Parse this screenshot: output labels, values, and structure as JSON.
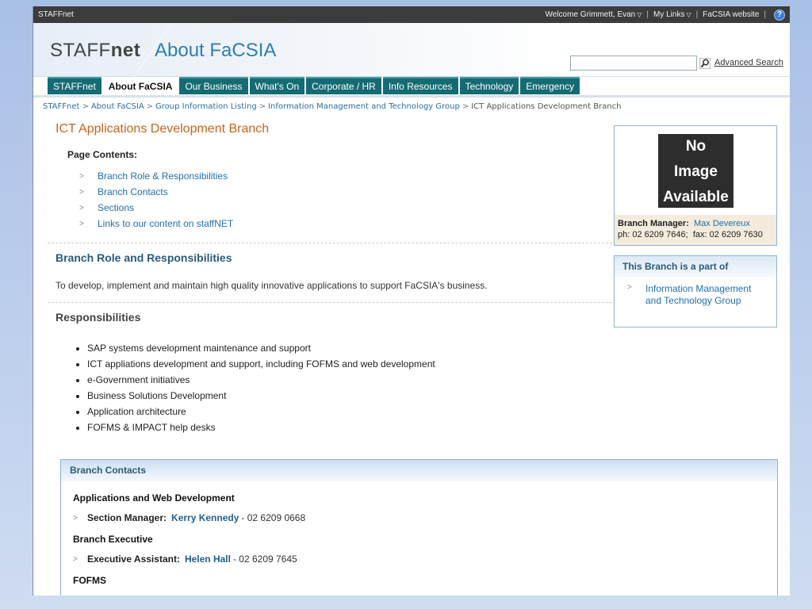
{
  "topbar": {
    "site_name": "STAFFnet",
    "welcome": "Welcome Grimmett, Evan",
    "my_links": "My Links",
    "facsia_website": "FaCSIA website",
    "help": "?"
  },
  "header": {
    "logo_light": "STAFF",
    "logo_bold": "net",
    "section_title": "About FaCSIA",
    "search_placeholder": "",
    "advanced_search": "Advanced Search"
  },
  "nav": {
    "tabs": [
      "STAFFnet",
      "About FaCSIA",
      "Our Business",
      "What's On",
      "Corporate / HR",
      "Info Resources",
      "Technology",
      "Emergency"
    ],
    "active": "About FaCSIA"
  },
  "breadcrumb": {
    "items": [
      "STAFFnet",
      "About FaCSIA",
      "Group Information Listing",
      "Information Management and Technology Group"
    ],
    "current": "ICT Applications Development Branch"
  },
  "main": {
    "title": "ICT Applications Development Branch",
    "contents_label": "Page Contents:",
    "toc": [
      "Branch Role & Responsibilities",
      "Branch Contacts",
      "Sections",
      "Links to our content on staffNET"
    ],
    "role_heading": "Branch Role and Responsibilities",
    "role_text": "To develop, implement and maintain high quality innovative applications to support FaCSIA's business.",
    "resp_heading": "Responsibilities",
    "responsibilities": [
      "SAP systems development maintenance and support",
      "ICT appliations development and support, including FOFMS and web development",
      "e-Government initiatives",
      "Business Solutions Development",
      "Application architecture",
      "FOFMS & IMPACT help desks"
    ]
  },
  "sidebar": {
    "no_image_lines": [
      "No",
      "Image",
      "Available"
    ],
    "manager_label": "Branch Manager:",
    "manager_name": "Max Devereux",
    "manager_phone": "ph: 02 6209 7646;",
    "manager_fax": "fax: 02 6209 7630",
    "part_of_heading": "This Branch is a part of",
    "part_of_link": "Information Management and Technology Group"
  },
  "contacts": {
    "heading": "Branch Contacts",
    "group1": "Applications and Web Development",
    "g1_role": "Section Manager:",
    "g1_name": "Kerry Kennedy",
    "g1_phone": "- 02 6209 0668",
    "group2": "Branch Executive",
    "g2_role": "Executive Assistant:",
    "g2_name": "Helen Hall",
    "g2_phone": "- 02 6209 7645",
    "group3": "FOFMS"
  }
}
